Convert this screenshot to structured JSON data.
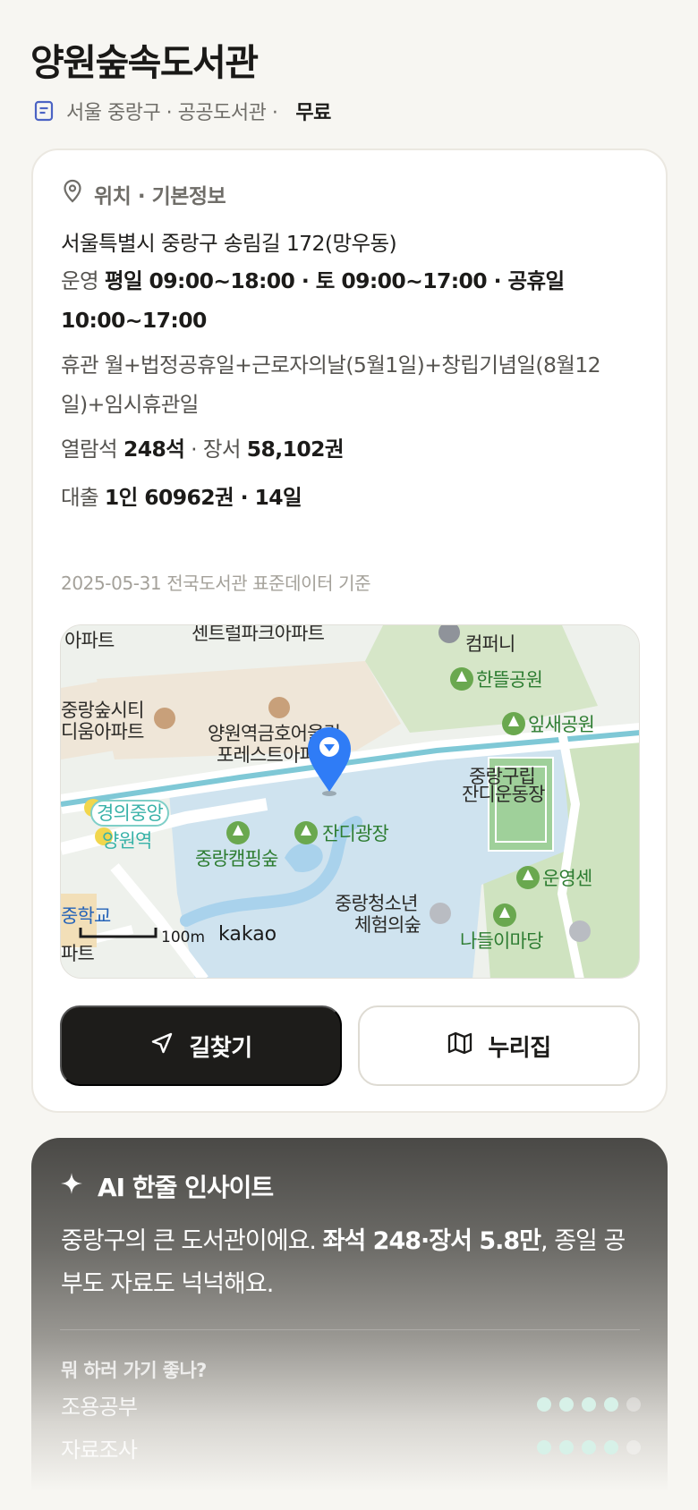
{
  "library": {
    "title": "양원숲속도서관",
    "subline": "서울 중랑구 · 공공도서관 · ",
    "fee": "무료"
  },
  "info": {
    "section_title": "위치 · 기본정보",
    "address": "서울특별시 중랑구 송림길 172(망우동)",
    "hours_label": "운영",
    "hours_value": "평일 09:00~18:00 · 토 09:00~17:00 · 공휴일 10:00~17:00",
    "closed_label": "휴관",
    "closed_value": "월+법정공휴일+근로자의날(5월1일)+창립기념일(8월12일)+임시휴관일",
    "seats_label": "열람석",
    "seats_value": "248석",
    "books_label": "장서",
    "books_value": "58,102권",
    "loan_label": "대출",
    "loan_value": "1인 60962권 · 14일",
    "basis": "2025-05-31 전국도서관 표준데이터 기준"
  },
  "map": {
    "labels": {
      "apt_left": "아파트",
      "central_park": "센트럴파크아파트",
      "company": "컴퍼니",
      "hanteul": "한뜰공원",
      "jungnang_forest_1": "중랑숲시티",
      "jungnang_forest_2": "디움아파트",
      "yangwon_1": "양원역금호어울림",
      "yangwon_2": "포레스트아파트",
      "ipsae": "잎새공원",
      "field_1": "중랑구립",
      "field_2": "잔디운동장",
      "gyeongui": "경의중앙",
      "yangwon_station": "양원역",
      "grass_plaza": "잔디광장",
      "camping": "중랑캠핑숲",
      "sports_center": "운영센",
      "youth_1": "중랑청소년",
      "youth_2": "체험의숲",
      "school": "중학교",
      "picnic": "나들이마당",
      "scale": "100m",
      "brand": "kakao",
      "apt_bottom": "파트"
    }
  },
  "actions": {
    "directions": "길찾기",
    "nurijip": "누리집"
  },
  "ai": {
    "title": "AI 한줄 인사이트",
    "text_a": "중랑구의 큰 도서관이에요. ",
    "text_b": "좌석 248·장서 5.8만",
    "text_c": ", 종일 공부도 자료도 넉넉해요.",
    "question": "뭐 하러 가기 좋나?",
    "ratings": [
      {
        "label": "조용공부",
        "score": 4,
        "max": 5
      },
      {
        "label": "자료조사",
        "score": 4,
        "max": 5
      }
    ]
  }
}
